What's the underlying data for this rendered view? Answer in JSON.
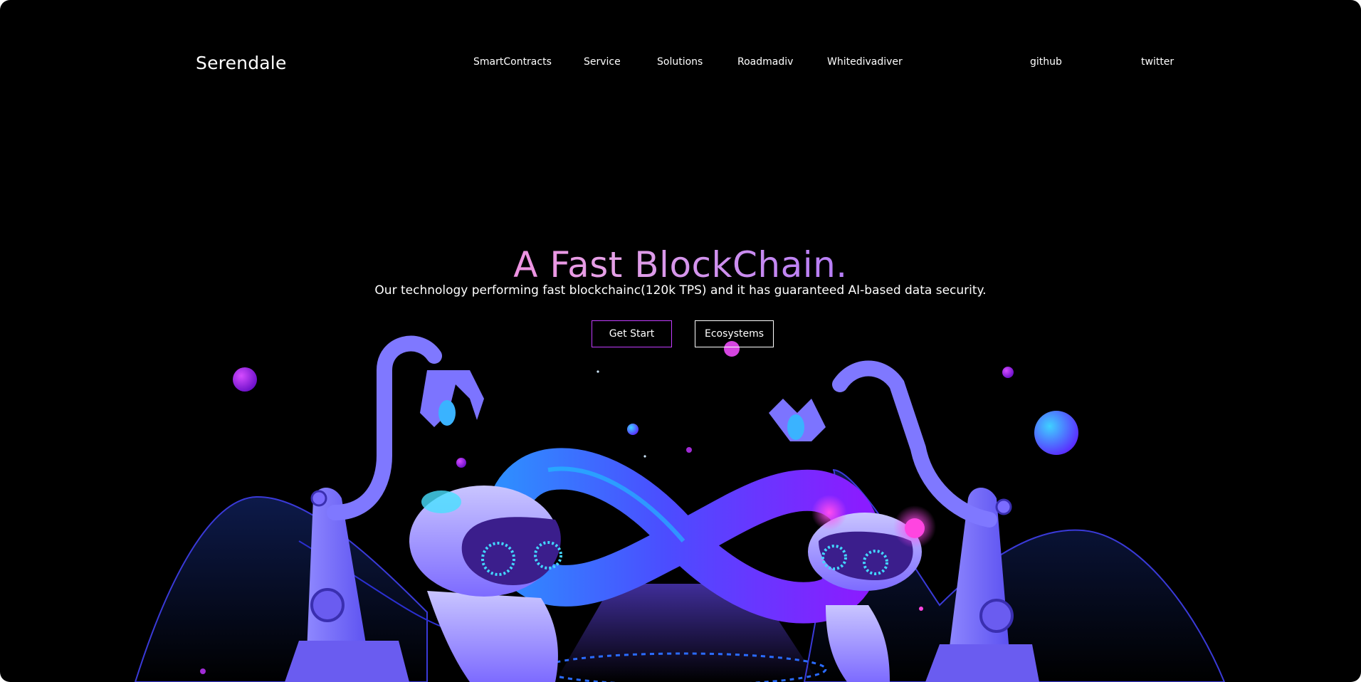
{
  "brand": {
    "name": "Serendale"
  },
  "nav": {
    "items": [
      {
        "label": "SmartContracts"
      },
      {
        "label": "Service"
      },
      {
        "label": "Solutions"
      },
      {
        "label": "Roadmadiv"
      },
      {
        "label": "Whitedivadiver"
      },
      {
        "label": "github"
      },
      {
        "label": "twitter"
      }
    ]
  },
  "hero": {
    "title": "A Fast BlockChain.",
    "subtitle": "Our technology performing fast blockchainc(120k TPS) and it has guaranteed AI-based data security.",
    "primary_button": "Get Start",
    "secondary_button": "Ecosystems"
  },
  "colors": {
    "background": "#000000",
    "accent_pink": "#ff4fd8",
    "accent_purple": "#7b2bff",
    "accent_blue": "#3f7bff"
  },
  "icons": {
    "illustration": "robots-infinity-illustration"
  }
}
